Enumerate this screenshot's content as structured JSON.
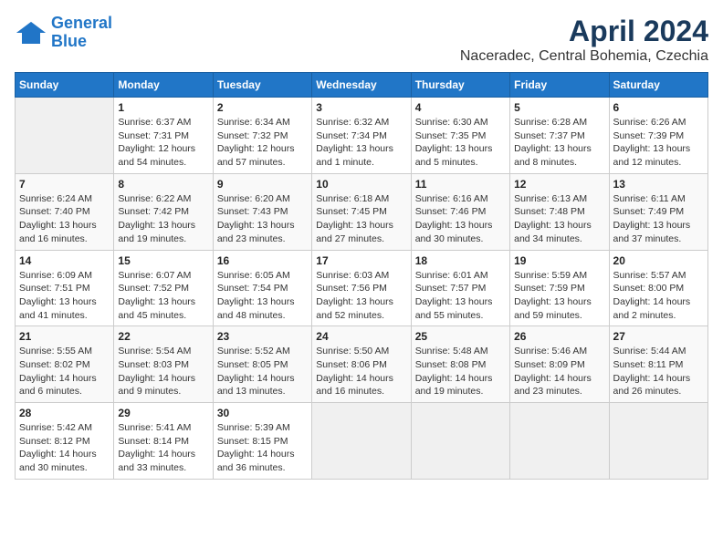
{
  "header": {
    "logo_line1": "General",
    "logo_line2": "Blue",
    "month": "April 2024",
    "location": "Naceradec, Central Bohemia, Czechia"
  },
  "weekdays": [
    "Sunday",
    "Monday",
    "Tuesday",
    "Wednesday",
    "Thursday",
    "Friday",
    "Saturday"
  ],
  "weeks": [
    [
      {
        "day": "",
        "info": ""
      },
      {
        "day": "1",
        "info": "Sunrise: 6:37 AM\nSunset: 7:31 PM\nDaylight: 12 hours\nand 54 minutes."
      },
      {
        "day": "2",
        "info": "Sunrise: 6:34 AM\nSunset: 7:32 PM\nDaylight: 12 hours\nand 57 minutes."
      },
      {
        "day": "3",
        "info": "Sunrise: 6:32 AM\nSunset: 7:34 PM\nDaylight: 13 hours\nand 1 minute."
      },
      {
        "day": "4",
        "info": "Sunrise: 6:30 AM\nSunset: 7:35 PM\nDaylight: 13 hours\nand 5 minutes."
      },
      {
        "day": "5",
        "info": "Sunrise: 6:28 AM\nSunset: 7:37 PM\nDaylight: 13 hours\nand 8 minutes."
      },
      {
        "day": "6",
        "info": "Sunrise: 6:26 AM\nSunset: 7:39 PM\nDaylight: 13 hours\nand 12 minutes."
      }
    ],
    [
      {
        "day": "7",
        "info": "Sunrise: 6:24 AM\nSunset: 7:40 PM\nDaylight: 13 hours\nand 16 minutes."
      },
      {
        "day": "8",
        "info": "Sunrise: 6:22 AM\nSunset: 7:42 PM\nDaylight: 13 hours\nand 19 minutes."
      },
      {
        "day": "9",
        "info": "Sunrise: 6:20 AM\nSunset: 7:43 PM\nDaylight: 13 hours\nand 23 minutes."
      },
      {
        "day": "10",
        "info": "Sunrise: 6:18 AM\nSunset: 7:45 PM\nDaylight: 13 hours\nand 27 minutes."
      },
      {
        "day": "11",
        "info": "Sunrise: 6:16 AM\nSunset: 7:46 PM\nDaylight: 13 hours\nand 30 minutes."
      },
      {
        "day": "12",
        "info": "Sunrise: 6:13 AM\nSunset: 7:48 PM\nDaylight: 13 hours\nand 34 minutes."
      },
      {
        "day": "13",
        "info": "Sunrise: 6:11 AM\nSunset: 7:49 PM\nDaylight: 13 hours\nand 37 minutes."
      }
    ],
    [
      {
        "day": "14",
        "info": "Sunrise: 6:09 AM\nSunset: 7:51 PM\nDaylight: 13 hours\nand 41 minutes."
      },
      {
        "day": "15",
        "info": "Sunrise: 6:07 AM\nSunset: 7:52 PM\nDaylight: 13 hours\nand 45 minutes."
      },
      {
        "day": "16",
        "info": "Sunrise: 6:05 AM\nSunset: 7:54 PM\nDaylight: 13 hours\nand 48 minutes."
      },
      {
        "day": "17",
        "info": "Sunrise: 6:03 AM\nSunset: 7:56 PM\nDaylight: 13 hours\nand 52 minutes."
      },
      {
        "day": "18",
        "info": "Sunrise: 6:01 AM\nSunset: 7:57 PM\nDaylight: 13 hours\nand 55 minutes."
      },
      {
        "day": "19",
        "info": "Sunrise: 5:59 AM\nSunset: 7:59 PM\nDaylight: 13 hours\nand 59 minutes."
      },
      {
        "day": "20",
        "info": "Sunrise: 5:57 AM\nSunset: 8:00 PM\nDaylight: 14 hours\nand 2 minutes."
      }
    ],
    [
      {
        "day": "21",
        "info": "Sunrise: 5:55 AM\nSunset: 8:02 PM\nDaylight: 14 hours\nand 6 minutes."
      },
      {
        "day": "22",
        "info": "Sunrise: 5:54 AM\nSunset: 8:03 PM\nDaylight: 14 hours\nand 9 minutes."
      },
      {
        "day": "23",
        "info": "Sunrise: 5:52 AM\nSunset: 8:05 PM\nDaylight: 14 hours\nand 13 minutes."
      },
      {
        "day": "24",
        "info": "Sunrise: 5:50 AM\nSunset: 8:06 PM\nDaylight: 14 hours\nand 16 minutes."
      },
      {
        "day": "25",
        "info": "Sunrise: 5:48 AM\nSunset: 8:08 PM\nDaylight: 14 hours\nand 19 minutes."
      },
      {
        "day": "26",
        "info": "Sunrise: 5:46 AM\nSunset: 8:09 PM\nDaylight: 14 hours\nand 23 minutes."
      },
      {
        "day": "27",
        "info": "Sunrise: 5:44 AM\nSunset: 8:11 PM\nDaylight: 14 hours\nand 26 minutes."
      }
    ],
    [
      {
        "day": "28",
        "info": "Sunrise: 5:42 AM\nSunset: 8:12 PM\nDaylight: 14 hours\nand 30 minutes."
      },
      {
        "day": "29",
        "info": "Sunrise: 5:41 AM\nSunset: 8:14 PM\nDaylight: 14 hours\nand 33 minutes."
      },
      {
        "day": "30",
        "info": "Sunrise: 5:39 AM\nSunset: 8:15 PM\nDaylight: 14 hours\nand 36 minutes."
      },
      {
        "day": "",
        "info": ""
      },
      {
        "day": "",
        "info": ""
      },
      {
        "day": "",
        "info": ""
      },
      {
        "day": "",
        "info": ""
      }
    ]
  ]
}
